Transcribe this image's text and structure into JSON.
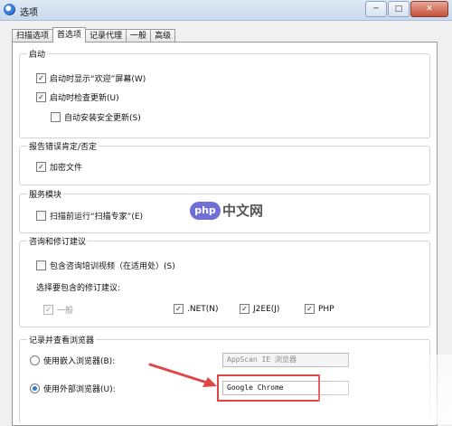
{
  "window": {
    "title": "选项",
    "btn_min": "─",
    "btn_max": "□",
    "btn_close": "✕"
  },
  "tabs": [
    {
      "label": "扫描选项"
    },
    {
      "label": "首选项"
    },
    {
      "label": "记录代理"
    },
    {
      "label": "一般"
    },
    {
      "label": "高级"
    }
  ],
  "startup": {
    "title": "启动",
    "show_welcome": "启动时显示“欢迎”屏幕(W)",
    "check_updates": "启动时检查更新(U)",
    "auto_install": "自动安装安全更新(S)"
  },
  "report": {
    "title": "报告错误肯定/否定",
    "encrypt": "加密文件"
  },
  "service": {
    "title": "服务模块",
    "run_expert": "扫描前运行“扫描专家”(E)"
  },
  "advisory": {
    "title": "咨询和修订建议",
    "include_videos": "包含咨询培训视频（在适用处）(S)",
    "choose_label": "选择要包含的修订建议:",
    "opt_general": "一般",
    "opt_net": ".NET(N)",
    "opt_j2ee": "J2EE(J)",
    "opt_php": "PHP"
  },
  "browser": {
    "title": "记录并查看浏览器",
    "embedded": "使用嵌入浏览器(B):",
    "embedded_value": "AppScan IE 浏览器",
    "external": "使用外部浏览器(U):",
    "external_value": "Google Chrome"
  },
  "watermark": {
    "badge": "php",
    "text": "中文网"
  },
  "colors": {
    "highlight": "#e14646",
    "arrow": "#e14646",
    "radio_dot": "#2a7fd4"
  }
}
